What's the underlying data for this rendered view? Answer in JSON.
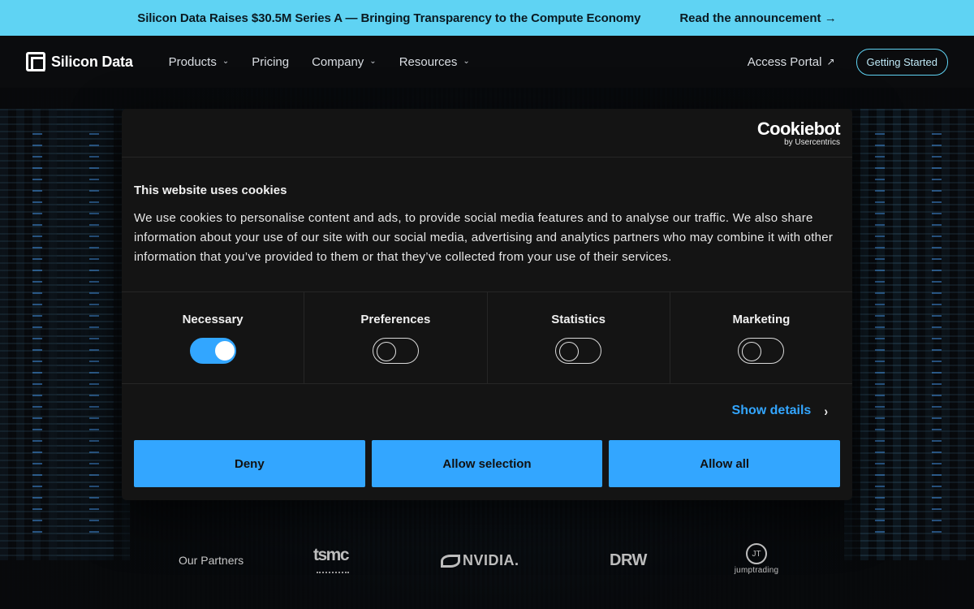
{
  "announcement": {
    "text": "Silicon Data Raises $30.5M Series A — Bringing Transparency to the Compute Economy",
    "link": "Read the announcement →"
  },
  "header": {
    "brand": "Silicon Data",
    "nav": [
      {
        "label": "Products",
        "has_menu": true
      },
      {
        "label": "Pricing",
        "has_menu": false
      },
      {
        "label": "Company",
        "has_menu": true
      },
      {
        "label": "Resources",
        "has_menu": true
      }
    ],
    "portal_label": "Access Portal",
    "portal_arrow": "↗",
    "cta_label": "Getting Started"
  },
  "cookie_dialog": {
    "vendor": {
      "name": "Cookiebot",
      "by": "by Usercentrics"
    },
    "title": "This website uses cookies",
    "body": "We use cookies to personalise content and ads, to provide social media features and to analyse our traffic. We also share information about your use of our site with our social media, advertising and analytics partners who may combine it with other information that you’ve provided to them or that they’ve collected from your use of their services.",
    "toggles": [
      {
        "label": "Necessary",
        "checked": true
      },
      {
        "label": "Preferences",
        "checked": false
      },
      {
        "label": "Statistics",
        "checked": false
      },
      {
        "label": "Marketing",
        "checked": false
      }
    ],
    "show_details": "Show details",
    "buttons": {
      "deny": "Deny",
      "allow_selection": "Allow selection",
      "allow_all": "Allow all"
    },
    "accent_color": "#33a6ff"
  },
  "partners": {
    "label": "Our Partners",
    "logos": [
      "tsmc",
      "NVIDIA.",
      "DRW",
      "jumptrading"
    ]
  },
  "colors": {
    "announcement_bg": "#5fd3f3",
    "page_bg": "#0a0b0d",
    "dialog_bg": "#141414"
  }
}
